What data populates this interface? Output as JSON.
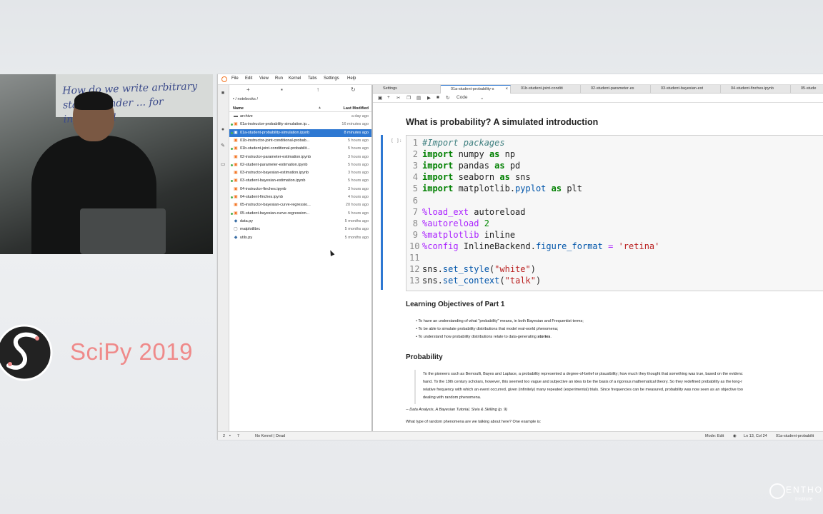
{
  "video": {
    "whiteboard_text": "How do we write arbitrary stats ... under ... for inferential"
  },
  "branding": {
    "scipy_title": "SciPy 2019",
    "enthought_text": "ENTHO",
    "enthought_sub": "Institute"
  },
  "menubar": {
    "items": [
      "File",
      "Edit",
      "View",
      "Run",
      "Kernel",
      "Tabs",
      "Settings",
      "Help"
    ]
  },
  "filebrowser": {
    "breadcrumb": "/ notebooks /",
    "header_name": "Name",
    "header_modified": "Last Modified",
    "files": [
      {
        "name": "archive",
        "modified": "a day ago",
        "icon": "folder-icon",
        "running": false,
        "selected": false
      },
      {
        "name": "01a-instructor-probability-simulation.ip...",
        "modified": "16 minutes ago",
        "icon": "notebook-icon",
        "running": true,
        "selected": false
      },
      {
        "name": "01a-student-probability-simulation.ipynb",
        "modified": "8 minutes ago",
        "icon": "notebook-icon",
        "running": true,
        "selected": true
      },
      {
        "name": "01b-instructor-joint-conditional-probab...",
        "modified": "5 hours ago",
        "icon": "notebook-icon",
        "running": false,
        "selected": false
      },
      {
        "name": "01b-student-joint-conditional-probabilit...",
        "modified": "5 hours ago",
        "icon": "notebook-icon",
        "running": true,
        "selected": false
      },
      {
        "name": "02-instructor-parameter-estimation.ipynb",
        "modified": "3 hours ago",
        "icon": "notebook-icon",
        "running": false,
        "selected": false
      },
      {
        "name": "02-student-parameter-estimation.ipynb",
        "modified": "5 hours ago",
        "icon": "notebook-icon",
        "running": true,
        "selected": false
      },
      {
        "name": "03-instructor-bayesian-estimation.ipynb",
        "modified": "3 hours ago",
        "icon": "notebook-icon",
        "running": false,
        "selected": false
      },
      {
        "name": "03-student-bayesian-estimation.ipynb",
        "modified": "5 hours ago",
        "icon": "notebook-icon",
        "running": true,
        "selected": false
      },
      {
        "name": "04-instructor-finches.ipynb",
        "modified": "3 hours ago",
        "icon": "notebook-icon",
        "running": false,
        "selected": false
      },
      {
        "name": "04-student-finches.ipynb",
        "modified": "4 hours ago",
        "icon": "notebook-icon",
        "running": true,
        "selected": false
      },
      {
        "name": "05-instructor-bayesian-curve-regressio...",
        "modified": "20 hours ago",
        "icon": "notebook-icon",
        "running": false,
        "selected": false
      },
      {
        "name": "05-student-bayesian-curve-regression...",
        "modified": "5 hours ago",
        "icon": "notebook-icon",
        "running": true,
        "selected": false
      },
      {
        "name": "data.py",
        "modified": "5 months ago",
        "icon": "python-icon",
        "running": false,
        "selected": false
      },
      {
        "name": "matplotlibrc",
        "modified": "5 months ago",
        "icon": "file-icon",
        "running": false,
        "selected": false
      },
      {
        "name": "utils.py",
        "modified": "5 months ago",
        "icon": "python-icon",
        "running": false,
        "selected": false
      }
    ]
  },
  "tabs": [
    {
      "label": "Settings",
      "active": false
    },
    {
      "label": "01a-student-probability-s",
      "active": true
    },
    {
      "label": "01b-student-joint-conditi",
      "active": false
    },
    {
      "label": "02-student-parameter-es",
      "active": false
    },
    {
      "label": "03-student-bayesian-est",
      "active": false
    },
    {
      "label": "04-student-finches.ipynb",
      "active": false
    },
    {
      "label": "05-stude",
      "active": false
    }
  ],
  "nbtoolbar": {
    "cell_type": "Code"
  },
  "notebook": {
    "title": "What is probability? A simulated introduction",
    "prompt": "[ ]:",
    "code_lines": [
      "#Import packages",
      "import numpy as np",
      "import pandas as pd",
      "import seaborn as sns",
      "import matplotlib.pyplot as plt",
      "",
      "%load_ext autoreload",
      "%autoreload 2",
      "%matplotlib inline",
      "%config InlineBackend.figure_format = 'retina'",
      "",
      "sns.set_style(\"white\")",
      "sns.set_context(\"talk\")"
    ],
    "objectives_heading": "Learning Objectives of Part 1",
    "objectives": [
      "To have an understanding of what \"probability\" means, in both Bayesian and Frequentist terms;",
      "To be able to simulate probability distributions that model real-world phenomena;",
      "To understand how probability distributions relate to data-generating "
    ],
    "objectives_bold_tail": "stories",
    "probability_heading": "Probability",
    "quote_lines": [
      "To the pioneers such as Bernoulli, Bayes and Laplace, a probability represented a degree-of-belief or plausibility; how much they thought that something was true, based on the evidenc",
      "hand. To the 19th century scholars, however, this seemed too vague and subjective an idea to be the basis of a rigorous mathematical theory. So they redefined probability as the long-r",
      "relative frequency with which an event occurred, given (infinitely) many repeated (experimental) trials. Since frequencies can be measured, probability was now seen as an objective too",
      "dealing with random phenomena."
    ],
    "citation": "-- Data Analysis, A Bayesian Tutorial, Sivia & Skilling (p. 9)",
    "question": "What type of random phenomena are we talking about here? One example is:"
  },
  "statusbar": {
    "count": "2",
    "count2": "7",
    "kernel": "No Kernel | Dead",
    "mode": "Mode: Edit",
    "position": "Ln 13, Col 24",
    "filename": "01a-student-probabilit"
  },
  "colors": {
    "accent": "#2e78d2",
    "scipy": "#ef8a8a",
    "running_dot": "#4caf50"
  }
}
